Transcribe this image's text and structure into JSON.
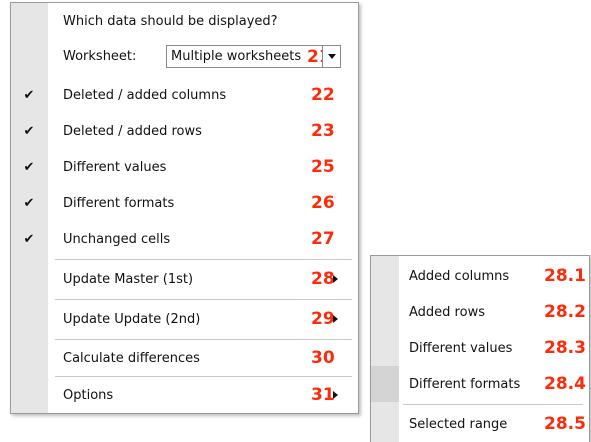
{
  "main_menu": {
    "header": "Which data should be displayed?",
    "worksheet_label": "Worksheet:",
    "worksheet_value": "Multiple worksheets",
    "worksheet_num": "21",
    "items": [
      {
        "label": "Deleted / added columns",
        "num": "22",
        "checked": true
      },
      {
        "label": "Deleted / added rows",
        "num": "23",
        "checked": true
      },
      {
        "label": "Different values",
        "num": "25",
        "checked": true
      },
      {
        "label": "Different formats",
        "num": "26",
        "checked": true
      },
      {
        "label": "Unchanged cells",
        "num": "27",
        "checked": true
      }
    ],
    "update_master": {
      "label": "Update Master (1st)",
      "num": "28"
    },
    "update_update": {
      "label": "Update Update (2nd)",
      "num": "29"
    },
    "calculate": {
      "label": "Calculate differences",
      "num": "30"
    },
    "options": {
      "label": "Options",
      "num": "31"
    }
  },
  "sub_menu": {
    "items": [
      {
        "label": "Added columns",
        "num": "28.1"
      },
      {
        "label": "Added rows",
        "num": "28.2"
      },
      {
        "label": "Different values",
        "num": "28.3"
      },
      {
        "label": "Different formats",
        "num": "28.4"
      },
      {
        "label": "Selected range",
        "num": "28.5"
      }
    ]
  },
  "colors": {
    "annotation": "#ff2a0a",
    "gutter": "#e6e6e6"
  },
  "icons": {
    "check": "check-icon",
    "submenu": "submenu-arrow-icon",
    "dropdown": "chevron-down-icon"
  }
}
